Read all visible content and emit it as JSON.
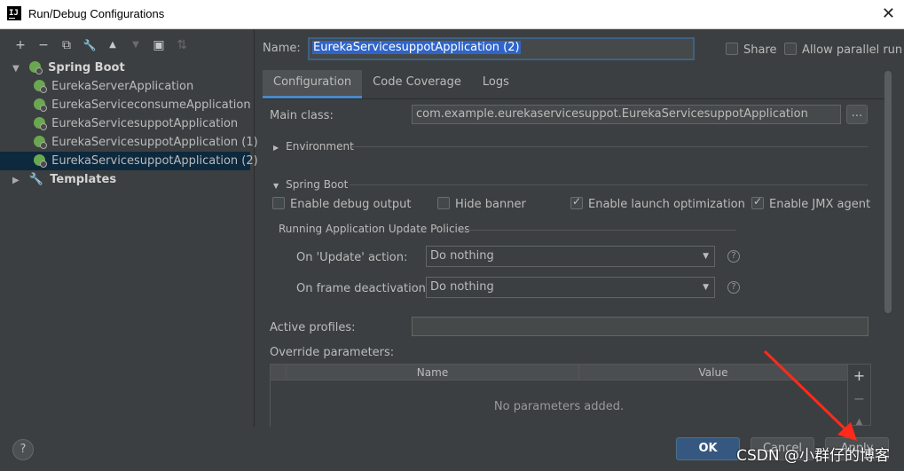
{
  "window": {
    "title": "Run/Debug Configurations",
    "close_glyph": "✕",
    "app_icon": "IJ"
  },
  "toolbar": {
    "add": "+",
    "remove": "−",
    "copy": "⧉",
    "edit": "🔧",
    "move_up": "▲",
    "move_down": "▼",
    "folder": "▣",
    "sort": "⇅"
  },
  "tree": {
    "root_label": "Spring Boot",
    "children": [
      "EurekaServerApplication",
      "EurekaServiceconsumeApplication",
      "EurekaServicesuppotApplication",
      "EurekaServicesuppotApplication (1)",
      "EurekaServicesuppotApplication (2)"
    ],
    "templates_label": "Templates"
  },
  "form": {
    "name_label": "Name:",
    "name_value": "EurekaServicesuppotApplication (2)",
    "share_label": "Share",
    "parallel_label": "Allow parallel run",
    "tabs": [
      "Configuration",
      "Code Coverage",
      "Logs"
    ],
    "main_class_label": "Main class:",
    "main_class_value": "com.example.eurekaservicesuppot.EurekaServicesuppotApplication",
    "dots": "...",
    "environment_label": "Environment",
    "spring_boot_label": "Spring Boot",
    "enable_debug_label": "Enable debug output",
    "hide_banner_label": "Hide banner",
    "launch_opt_label": "Enable launch optimization",
    "jmx_label": "Enable JMX agent",
    "update_policies_label": "Running Application Update Policies",
    "on_update_label": "On 'Update' action:",
    "on_update_value": "Do nothing",
    "on_frame_label": "On frame deactivation:",
    "on_frame_value": "Do nothing",
    "active_profiles_label": "Active profiles:",
    "override_label": "Override parameters:",
    "col_name": "Name",
    "col_value": "Value",
    "empty_text": "No parameters added.",
    "help_glyph": "?"
  },
  "buttons": {
    "ok": "OK",
    "cancel": "Cancel",
    "apply": "Apply",
    "help": "?"
  },
  "watermark": "CSDN @小群仔的博客",
  "colors": {
    "accent": "#4a88c7",
    "selection": "#2f65ca",
    "arrow": "#ff2a1a"
  }
}
